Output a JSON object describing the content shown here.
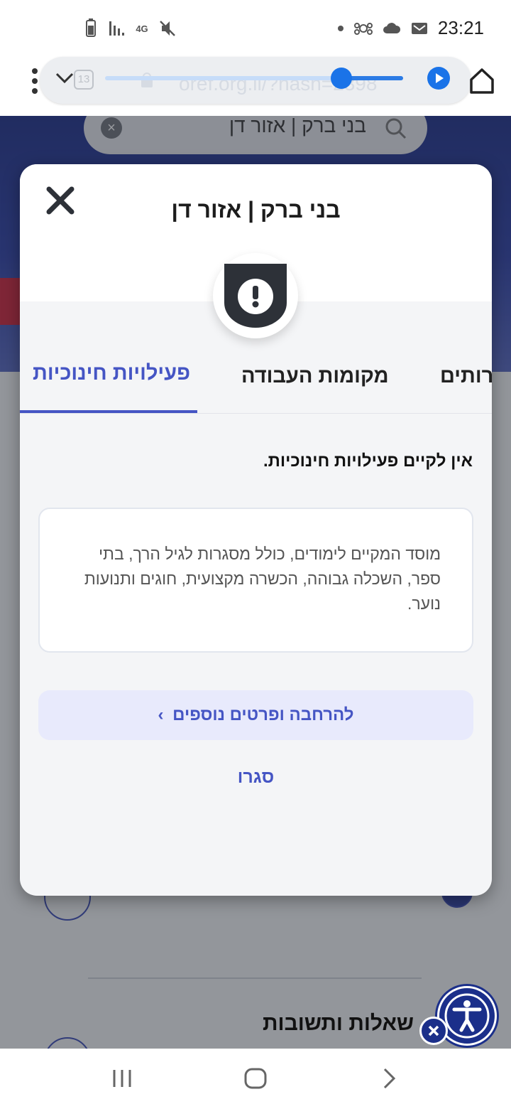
{
  "status_bar": {
    "time": "23:21",
    "network_label": "4G",
    "icons": [
      "battery-icon",
      "signal-icon",
      "network-4g-icon",
      "mute-icon",
      "dot-icon",
      "sync-icon",
      "cloud-icon",
      "mail-icon"
    ]
  },
  "browser": {
    "url": "oref.org.il/?hash=2398",
    "tab_count": "13",
    "icons": [
      "menu-dots-icon",
      "chevron-down-icon",
      "lock-icon",
      "play-icon",
      "home-icon"
    ]
  },
  "background_page": {
    "search_value": "בני ברק | אזור דן",
    "section_title": "שאלות ותשובות"
  },
  "modal": {
    "title": "בני ברק | אזור דן",
    "tabs": [
      {
        "label": "פעילויות חינוכיות",
        "active": true
      },
      {
        "label": "מקומות העבודה",
        "active": false
      },
      {
        "label": "רותים",
        "active": false
      }
    ],
    "status_message": "אין לקיים פעילויות חינוכיות.",
    "description": "מוסד המקיים לימודים, כולל מסגרות לגיל הרך, בתי ספר, השכלה גבוהה, הכשרה מקצועית, חוגים ותנועות נוער.",
    "more_details_label": "להרחבה ופרטים נוספים",
    "close_label": "סגרו"
  },
  "colors": {
    "accent": "#4555c4",
    "hero_blue": "#1b2d8a",
    "alert_red": "#d0213a",
    "shield_dark": "#2d3138"
  }
}
